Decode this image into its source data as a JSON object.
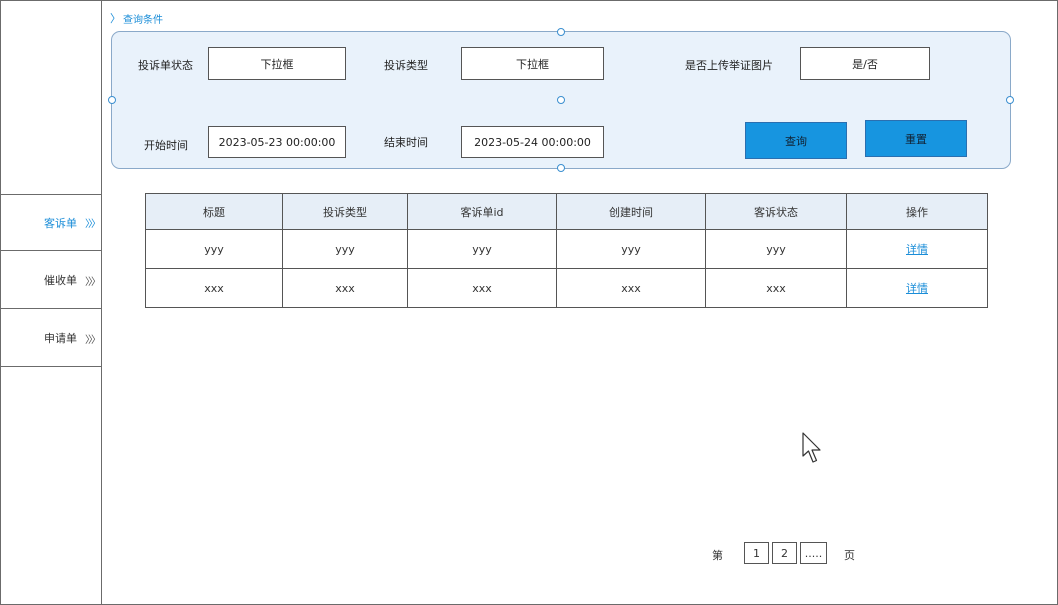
{
  "sidebar": {
    "items": [
      {
        "label": "客诉单",
        "chevrons": "〉〉〉",
        "active": true
      },
      {
        "label": "催收单",
        "chevrons": "〉〉〉",
        "active": false
      },
      {
        "label": "申请单",
        "chevrons": "〉〉〉",
        "active": false
      }
    ]
  },
  "query": {
    "header": "查询条件",
    "header_chevron": "〉",
    "fields": {
      "status_label": "投诉单状态",
      "status_value": "下拉框",
      "type_label": "投诉类型",
      "type_value": "下拉框",
      "upload_label": "是否上传举证图片",
      "upload_value": "是/否",
      "start_label": "开始时间",
      "start_value": "2023-05-23 00:00:00",
      "end_label": "结束时间",
      "end_value": "2023-05-24 00:00:00"
    },
    "buttons": {
      "search": "查询",
      "reset": "重置"
    }
  },
  "table": {
    "headers": [
      "标题",
      "投诉类型",
      "客诉单id",
      "创建时间",
      "客诉状态",
      "操作"
    ],
    "rows": [
      [
        "yyy",
        "yyy",
        "yyy",
        "yyy",
        "yyy",
        "详情"
      ],
      [
        "xxx",
        "xxx",
        "xxx",
        "xxx",
        "xxx",
        "详情"
      ]
    ]
  },
  "pagination": {
    "prefix": "第",
    "pages": [
      "1",
      "2",
      "....."
    ],
    "suffix": "页"
  },
  "colors": {
    "accent": "#1a8dd8",
    "button_blue": "#1795e0",
    "panel_bg": "#e9f2fb",
    "header_bg": "#e6eef7"
  }
}
